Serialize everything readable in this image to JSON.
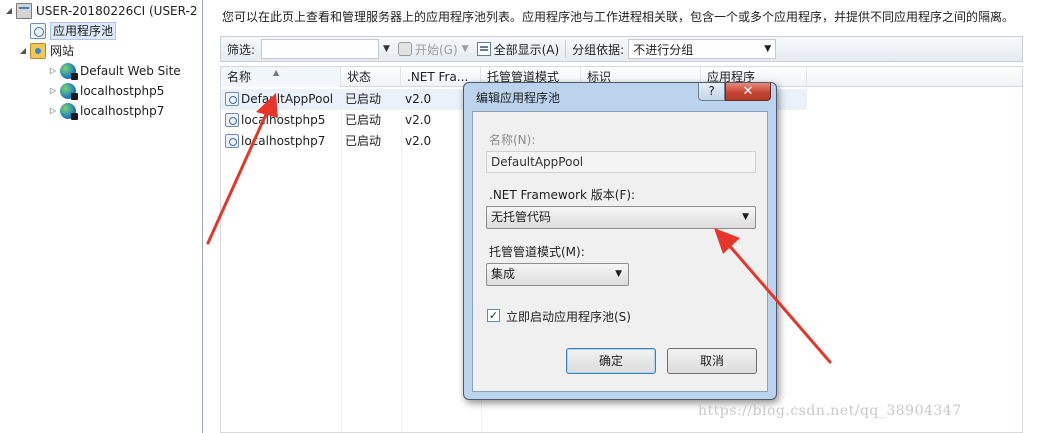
{
  "tree": {
    "server": {
      "label": "USER-20180226CI (USER-2",
      "icon": "server-icon"
    },
    "app_pools": {
      "label": "应用程序池",
      "icon": "app-pool-icon"
    },
    "sites": {
      "label": "网站",
      "icon": "sites-folder-icon"
    },
    "site_items": [
      {
        "label": "Default Web Site",
        "icon": "globe-icon"
      },
      {
        "label": "localhostphp5",
        "icon": "globe-icon"
      },
      {
        "label": "localhostphp7",
        "icon": "globe-icon"
      }
    ]
  },
  "main": {
    "description": "您可以在此页上查看和管理服务器上的应用程序池列表。应用程序池与工作进程相关联，包含一个或多个应用程序，并提供不同应用程序之间的隔离。",
    "toolbar": {
      "filter_label": "筛选:",
      "start_label": "开始(G)",
      "show_all_label": "全部显示(A)",
      "group_by_label": "分组依据:",
      "group_by_value": "不进行分组"
    },
    "grid": {
      "columns": [
        "名称",
        "状态",
        ".NET Fra...",
        "托管管道模式",
        "标识",
        "应用程序"
      ],
      "rows": [
        {
          "name": "DefaultAppPool",
          "status": "已启动",
          "framework": "v2.0"
        },
        {
          "name": "localhostphp5",
          "status": "已启动",
          "framework": "v2.0"
        },
        {
          "name": "localhostphp7",
          "status": "已启动",
          "framework": "v2.0"
        }
      ]
    }
  },
  "dialog": {
    "title": "编辑应用程序池",
    "help": "?",
    "close": "✕",
    "name_label": "名称(N):",
    "name_value": "DefaultAppPool",
    "framework_label": ".NET Framework 版本(F):",
    "framework_value": "无托管代码",
    "pipeline_label": "托管管道模式(M):",
    "pipeline_value": "集成",
    "autostart_label": "立即启动应用程序池(S)",
    "autostart_checked": true,
    "ok": "确定",
    "cancel": "取消"
  },
  "watermark": "https://blog.csdn.net/qq_38904347",
  "colors": {
    "annotation_arrow": "#e8352a",
    "dialog_frame": "#bcd3ee",
    "close_button": "#c44534",
    "selection": "#dde9f7"
  }
}
